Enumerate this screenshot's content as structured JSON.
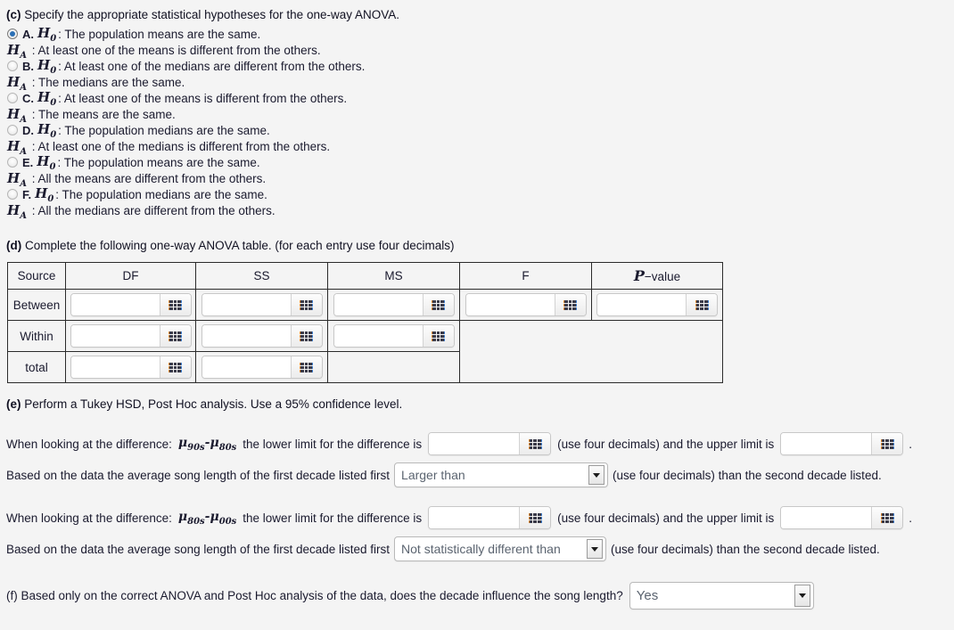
{
  "part_c": {
    "label": "(c)",
    "prompt": "Specify the appropriate statistical hypotheses for the one-way ANOVA.",
    "options": [
      {
        "letter": "A.",
        "selected": true,
        "h0_symbol": "H",
        "h0_sub": "0",
        "h0_text": ": The population means are the same.",
        "ha_symbol": "H",
        "ha_sub": "A",
        "ha_text": ": At least one of the means is different from the others."
      },
      {
        "letter": "B.",
        "selected": false,
        "h0_symbol": "H",
        "h0_sub": "0",
        "h0_text": ": At least one of the medians are different from the others.",
        "ha_symbol": "H",
        "ha_sub": "A",
        "ha_text": ": The medians are the same."
      },
      {
        "letter": "C.",
        "selected": false,
        "h0_symbol": "H",
        "h0_sub": "0",
        "h0_text": ": At least one of the means is different from the others.",
        "ha_symbol": "H",
        "ha_sub": "A",
        "ha_text": ": The means are the same."
      },
      {
        "letter": "D.",
        "selected": false,
        "h0_symbol": "H",
        "h0_sub": "0",
        "h0_text": ": The population medians are the same.",
        "ha_symbol": "H",
        "ha_sub": "A",
        "ha_text": ": At least one of the medians is different from the others."
      },
      {
        "letter": "E.",
        "selected": false,
        "h0_symbol": "H",
        "h0_sub": "0",
        "h0_text": ": The population means are the same.",
        "ha_symbol": "H",
        "ha_sub": "A",
        "ha_text": ": All the means are different from the others."
      },
      {
        "letter": "F.",
        "selected": false,
        "h0_symbol": "H",
        "h0_sub": "0",
        "h0_text": ": The population medians are the same.",
        "ha_symbol": "H",
        "ha_sub": "A",
        "ha_text": ": All the medians are different from the others."
      }
    ]
  },
  "part_d": {
    "label": "(d)",
    "prompt": "Complete the following one-way ANOVA table. (for each entry use four decimals)",
    "headers": {
      "source": "Source",
      "df": "DF",
      "ss": "SS",
      "ms": "MS",
      "f": "F",
      "p_symbol": "P",
      "p_rest": "−value"
    },
    "rows": [
      {
        "source": "Between",
        "inputs": [
          "",
          "",
          "",
          "",
          ""
        ]
      },
      {
        "source": "Within",
        "inputs": [
          "",
          "",
          ""
        ]
      },
      {
        "source": "total",
        "inputs": [
          "",
          ""
        ]
      }
    ],
    "input_placeholder": "",
    "pad_icon": "grid-keypad-icon"
  },
  "part_e": {
    "label": "(e)",
    "prompt": "Perform a Tukey HSD, Post Hoc analysis. Use a 95% confidence level.",
    "comparisons": [
      {
        "lead_text": "When looking at the difference:",
        "mu1_sub": "90s",
        "mu2_sub": "80s",
        "mid_text": "the lower limit for the difference is",
        "lower_value": "",
        "after_lower": "(use four decimals) and the upper limit is",
        "upper_value": "",
        "end_punct": ".",
        "concl_prefix": "Based on the data the average song length of the first decade listed first",
        "concl_select": "Larger than",
        "concl_suffix": "(use four decimals) than the second decade listed."
      },
      {
        "lead_text": "When looking at the difference:",
        "mu1_sub": "80s",
        "mu2_sub": "00s",
        "mid_text": "the lower limit for the difference is",
        "lower_value": "",
        "after_lower": "(use four decimals) and the upper limit is",
        "upper_value": "",
        "end_punct": ".",
        "concl_prefix": "Based on the data the average song length of the first decade listed first",
        "concl_select": "Not statistically different than",
        "concl_suffix": "(use four decimals) than the second decade listed."
      }
    ],
    "mu_symbol": "μ",
    "minus": "-"
  },
  "part_f": {
    "label": "(f)",
    "prompt": "Based only on the correct ANOVA and Post Hoc analysis of the data, does the decade influence the song length?",
    "answer": "Yes"
  },
  "colors": {
    "page_bg": "#f4f4f4",
    "text": "#111122",
    "radio_dot": "#2a6fb5",
    "table_border": "#2b2b2b",
    "select_text": "#5b6470",
    "icon_orange": "#e08a30",
    "icon_blue": "#3e7fd0"
  }
}
